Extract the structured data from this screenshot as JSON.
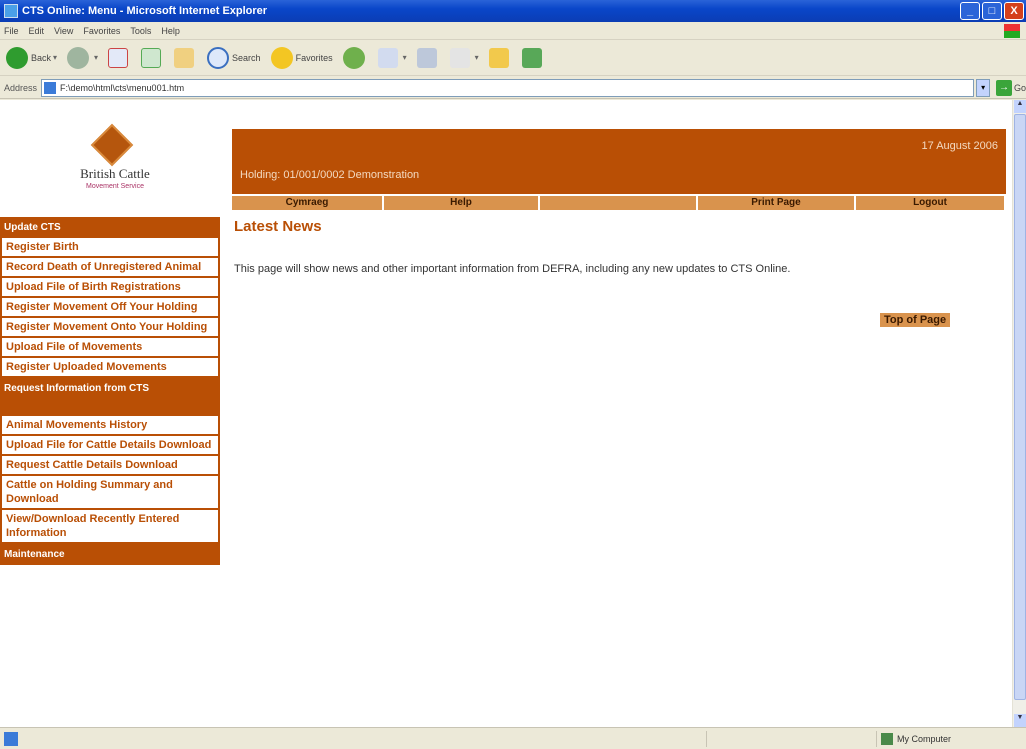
{
  "window": {
    "title": "CTS Online: Menu - Microsoft Internet Explorer",
    "buttons": [
      "_",
      "□",
      "X"
    ]
  },
  "menubar": [
    "File",
    "Edit",
    "View",
    "Favorites",
    "Tools",
    "Help"
  ],
  "toolbar": {
    "back": "Back",
    "search": "Search",
    "favorites": "Favorites"
  },
  "address": {
    "label": "Address",
    "value": "F:\\demo\\html\\cts\\menu001.htm",
    "go": "Go"
  },
  "logo": {
    "name": "British Cattle",
    "subtitle": "Movement Service"
  },
  "sidebar": {
    "sections": [
      {
        "heading": "Update CTS",
        "items": [
          "Register Birth",
          "Record Death of Unregistered Animal",
          "Upload File of Birth Registrations",
          "Register Movement Off Your Holding",
          "Register Movement Onto Your Holding",
          "Upload File of Movements",
          "Register Uploaded Movements"
        ]
      },
      {
        "heading": "Request Information from CTS",
        "items": [
          "Animal Movements History",
          "Upload File for Cattle Details Download",
          "Request Cattle Details Download",
          "Cattle on Holding Summary and Download",
          "View/Download Recently Entered Information"
        ]
      },
      {
        "heading": "Maintenance",
        "items": []
      }
    ]
  },
  "header": {
    "date": "17 August 2006",
    "holding": "Holding: 01/001/0002 Demonstration"
  },
  "nav": [
    "Cymraeg",
    "Help",
    "",
    "Print Page",
    "Logout"
  ],
  "main": {
    "heading": "Latest News",
    "body": "This page will show news and other important information from DEFRA, including any new updates to CTS Online.",
    "top_of_page": "Top of Page"
  },
  "status": {
    "zone": "My Computer"
  }
}
